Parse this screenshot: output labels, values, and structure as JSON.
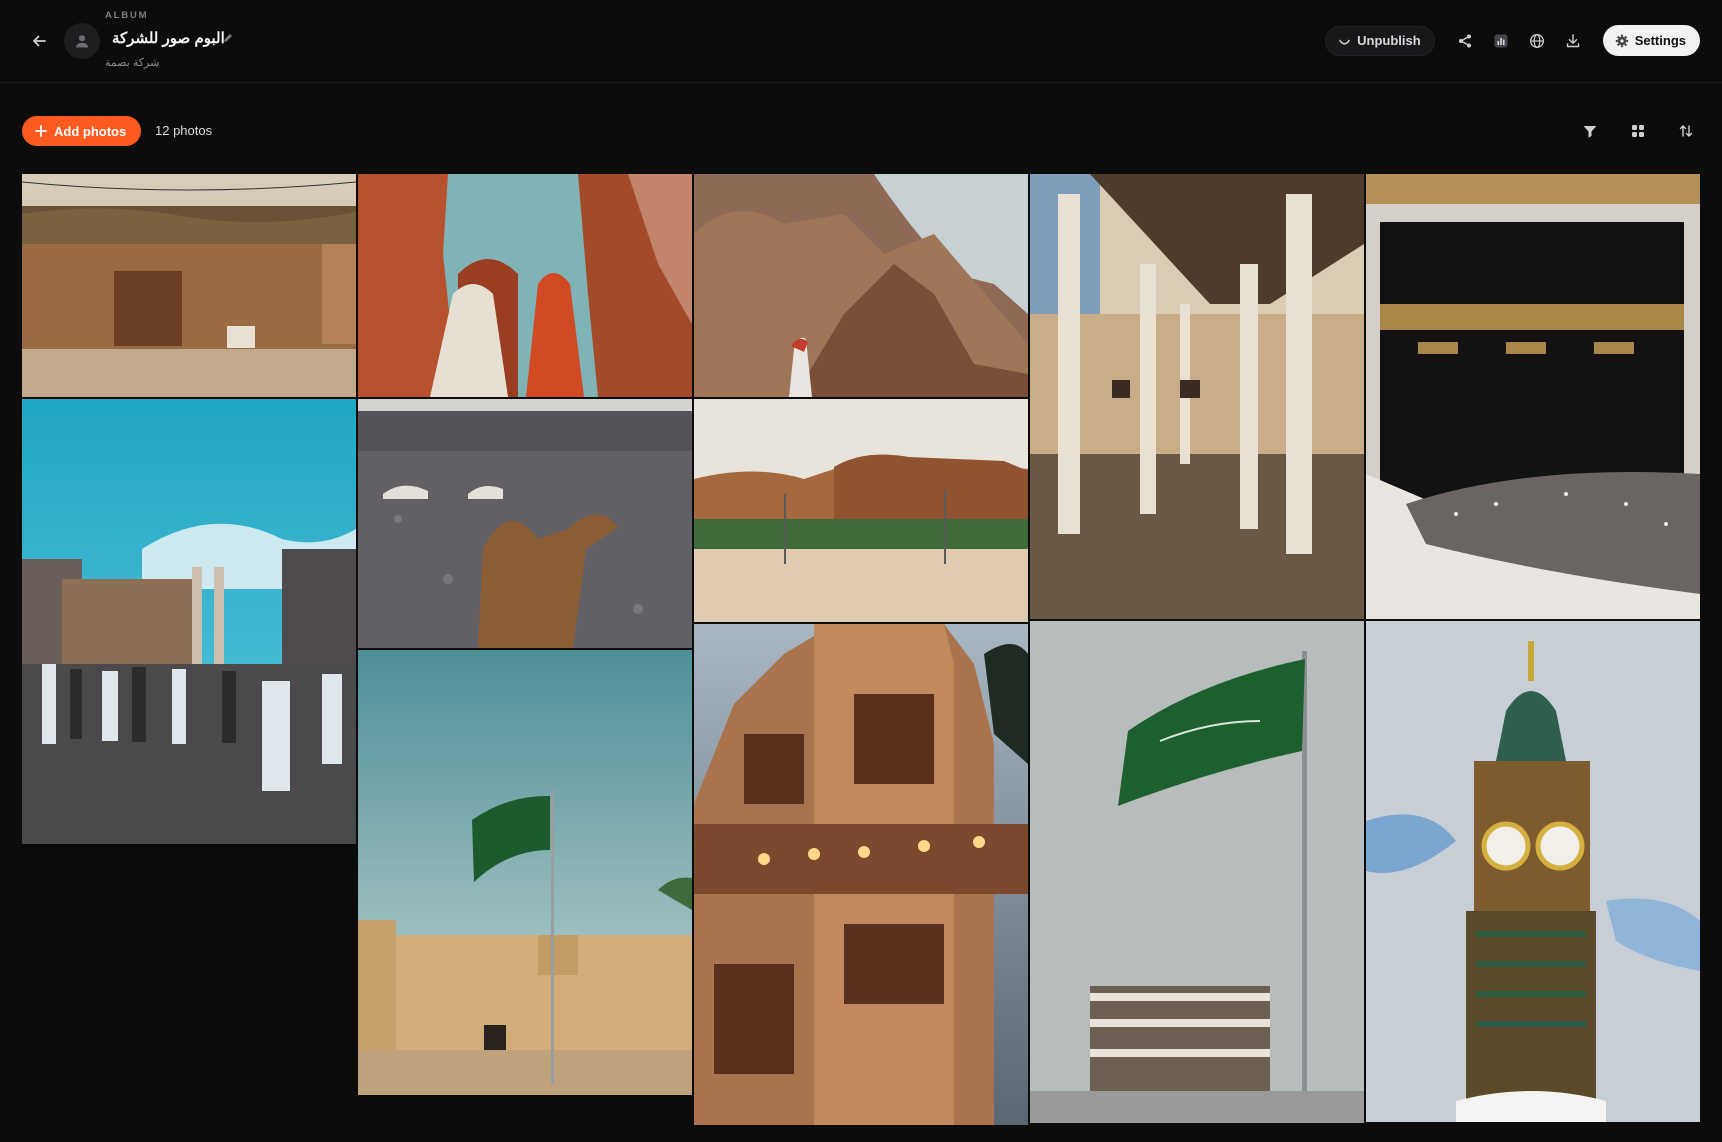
{
  "header": {
    "kicker": "ALBUM",
    "title": "البوم صور للشركة",
    "subtitle": "شركة بصمة",
    "unpublish_label": "Unpublish",
    "settings_label": "Settings",
    "icons": [
      "back-arrow-icon",
      "user-icon",
      "pencil-icon",
      "share-icon",
      "stats-icon",
      "globe-icon",
      "download-icon",
      "gear-icon"
    ]
  },
  "toolbar": {
    "add_photos_label": "Add photos",
    "photo_count": "12 photos",
    "icons": [
      "filter-icon",
      "grid-view-icon",
      "sort-icon"
    ]
  },
  "colors": {
    "accent": "#ff5b21",
    "background": "#0c0c0d",
    "settings_bg": "#f2f2f2"
  },
  "photos": [
    {
      "subject": "mud-brick-house"
    },
    {
      "subject": "women-in-red-canyon"
    },
    {
      "subject": "desert-mountains-man"
    },
    {
      "subject": "colonnade-walkway"
    },
    {
      "subject": "kaaba"
    },
    {
      "subject": "crowd-mecca-minarets"
    },
    {
      "subject": "camels-rocky-desert"
    },
    {
      "subject": "alula-rock-formations"
    },
    {
      "subject": "flag-over-fort"
    },
    {
      "subject": "historic-jeddah-building"
    },
    {
      "subject": "saudi-flag-pole"
    },
    {
      "subject": "makkah-clock-tower"
    }
  ]
}
